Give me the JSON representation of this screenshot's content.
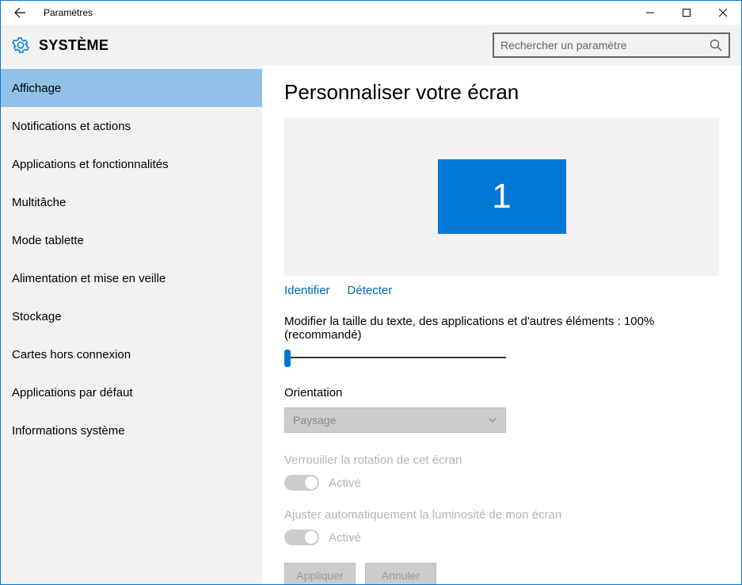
{
  "titlebar": {
    "title": "Paramètres"
  },
  "header": {
    "category": "SYSTÈME",
    "search_placeholder": "Rechercher un paramètre"
  },
  "sidebar": {
    "items": [
      {
        "label": "Affichage",
        "selected": true
      },
      {
        "label": "Notifications et actions",
        "selected": false
      },
      {
        "label": "Applications et fonctionnalités",
        "selected": false
      },
      {
        "label": "Multitâche",
        "selected": false
      },
      {
        "label": "Mode tablette",
        "selected": false
      },
      {
        "label": "Alimentation et mise en veille",
        "selected": false
      },
      {
        "label": "Stockage",
        "selected": false
      },
      {
        "label": "Cartes hors connexion",
        "selected": false
      },
      {
        "label": "Applications par défaut",
        "selected": false
      },
      {
        "label": "Informations système",
        "selected": false
      }
    ]
  },
  "content": {
    "heading": "Personnaliser votre écran",
    "monitor_number": "1",
    "link_identify": "Identifier",
    "link_detect": "Détecter",
    "scale_label": "Modifier la taille du texte, des applications et d'autres éléments : 100% (recommandé)",
    "orientation_label": "Orientation",
    "orientation_value": "Paysage",
    "lock_rotation_label": "Verrouiller la rotation de cet écran",
    "lock_rotation_state": "Activé",
    "auto_brightness_label": "Ajuster automatiquement la luminosité de mon écran",
    "auto_brightness_state": "Activé",
    "apply_label": "Appliquer",
    "cancel_label": "Annuler"
  }
}
